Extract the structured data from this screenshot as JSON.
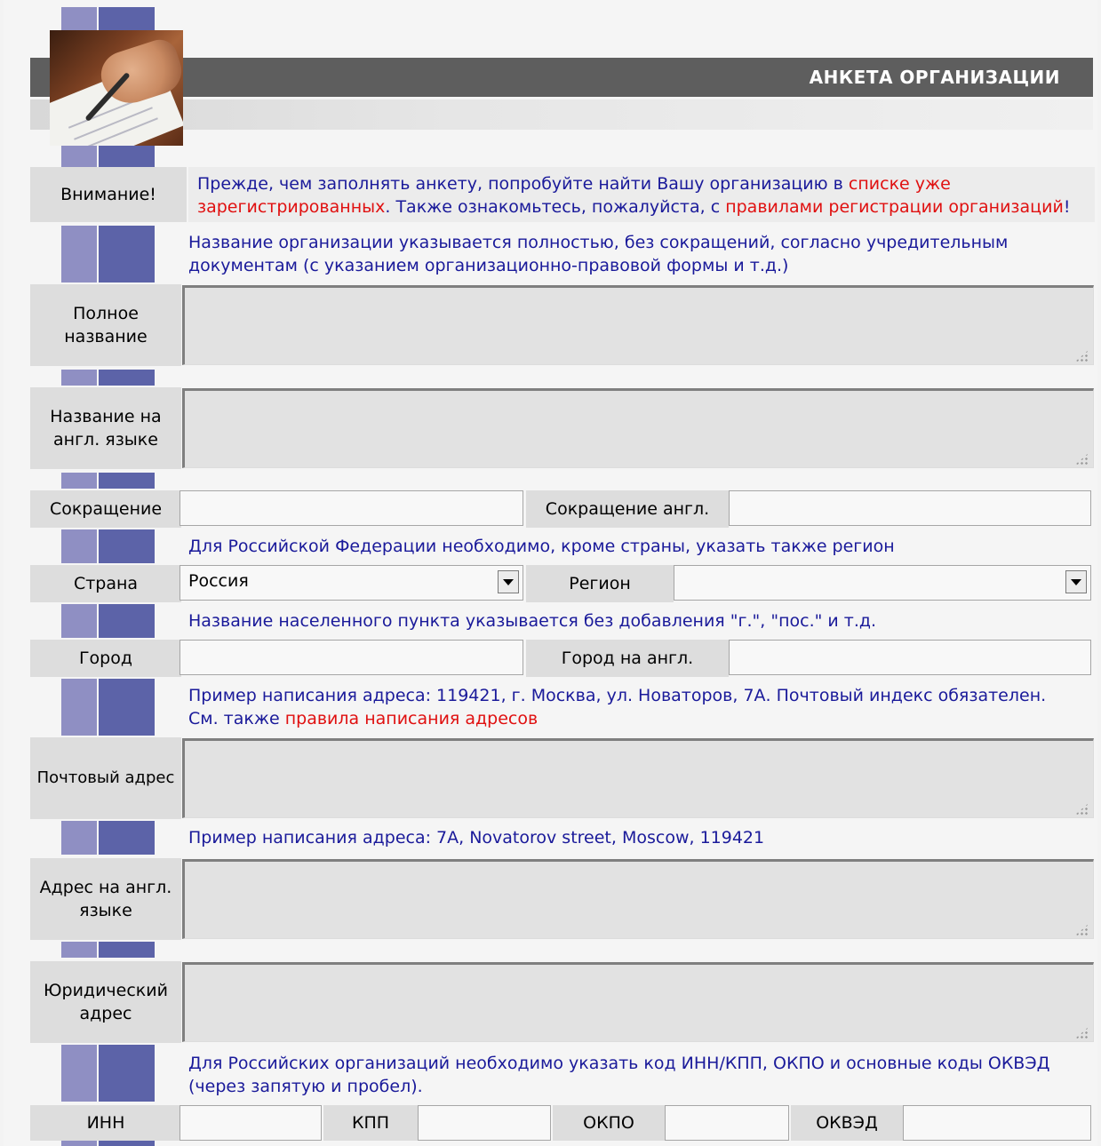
{
  "header": {
    "title": "АНКЕТА  ОРГАНИЗАЦИИ"
  },
  "notice": {
    "label": "Внимание!",
    "text_1": "Прежде, чем заполнять анкету, попробуйте найти Вашу организацию в ",
    "link_1": "списке уже зарегистрированных",
    "text_2": ". Также ознакомьтесь, пожалуйста, с ",
    "link_2": "правилами регистрации организаций",
    "text_3": "!"
  },
  "hints": {
    "full_name": "Название организации указывается полностью, без сокращений, согласно учредительным документам (с указанием организационно-правовой формы и т.д.)",
    "region": "Для Российской Федерации необходимо, кроме страны, указать также регион",
    "city": "Название населенного пункта указывается без добавления \"г.\", \"пос.\" и т.д.",
    "postal_1": "Пример написания адреса: 119421, г. Москва, ул. Новаторов, 7А. Почтовый индекс обязателен.",
    "postal_2_text": "См. также ",
    "postal_2_link": "правила написания адресов",
    "address_en": "Пример написания адреса: 7A, Novatorov street, Moscow, 119421",
    "codes": "Для Российских организаций необходимо указать код ИНН/КПП, ОКПО и основные коды ОКВЭД (через запятую и пробел)."
  },
  "fields": {
    "full_name": {
      "label": "Полное название",
      "value": ""
    },
    "name_en": {
      "label": "Название на англ. языке",
      "value": ""
    },
    "short": {
      "label": "Сокращение",
      "value": ""
    },
    "short_en": {
      "label": "Сокращение англ.",
      "value": ""
    },
    "country": {
      "label": "Страна",
      "value": "Россия"
    },
    "region": {
      "label": "Регион",
      "value": ""
    },
    "city": {
      "label": "Город",
      "value": ""
    },
    "city_en": {
      "label": "Город на англ.",
      "value": ""
    },
    "postal_address": {
      "label": "Почтовый адрес",
      "value": ""
    },
    "address_en": {
      "label": "Адрес на англ. языке",
      "value": ""
    },
    "legal_address": {
      "label": "Юридический адрес",
      "value": ""
    },
    "inn": {
      "label": "ИНН",
      "value": ""
    },
    "kpp": {
      "label": "КПП",
      "value": ""
    },
    "okpo": {
      "label": "ОКПО",
      "value": ""
    },
    "okved": {
      "label": "ОКВЭД",
      "value": ""
    }
  },
  "icons": {
    "photo": "writing-hand-photo",
    "dropdown": "chevron-down-icon",
    "resize": "resize-grip-icon"
  },
  "colors": {
    "header_bar": "#5e5e5e",
    "hint_text": "#1a1a9a",
    "link": "#e01010",
    "stripe_light": "#8f8fc3",
    "stripe_dark": "#5c63a8",
    "label_bg": "#dddddd"
  }
}
